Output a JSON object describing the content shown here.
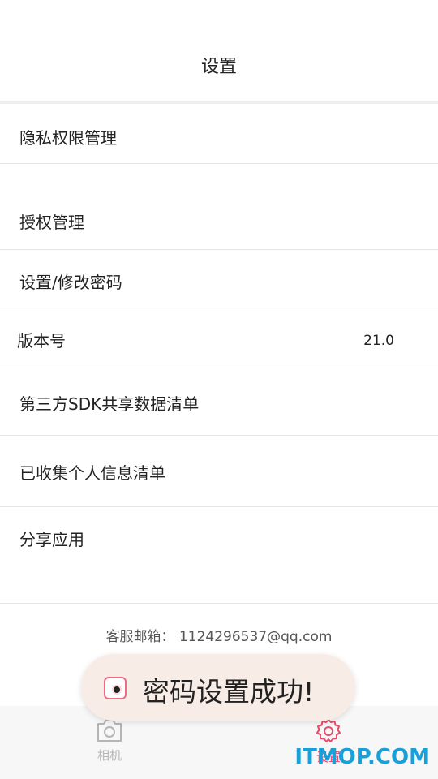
{
  "header": {
    "title": "设置"
  },
  "settings": {
    "privacy": "隐私权限管理",
    "auth": "授权管理",
    "password": "设置/修改密码",
    "version_label": "版本号",
    "version_value": "21.0",
    "sdk_list": "第三方SDK共享数据清单",
    "personal_info": "已收集个人信息清单",
    "share": "分享应用"
  },
  "contact": {
    "label": "客服邮箱：",
    "email": "1124296537@qq.com"
  },
  "tabs": [
    {
      "label": "相机",
      "icon": "camera-icon",
      "active": false
    },
    {
      "label": "设置",
      "icon": "gear-icon",
      "active": true
    }
  ],
  "toast": {
    "text": "密码设置成功!"
  },
  "watermark": "ITMOP.COM",
  "colors": {
    "accent": "#e84c6a",
    "toast_bg": "#f8ede6",
    "watermark": "#1aa0d8",
    "tab_inactive": "#b5b5b5"
  }
}
